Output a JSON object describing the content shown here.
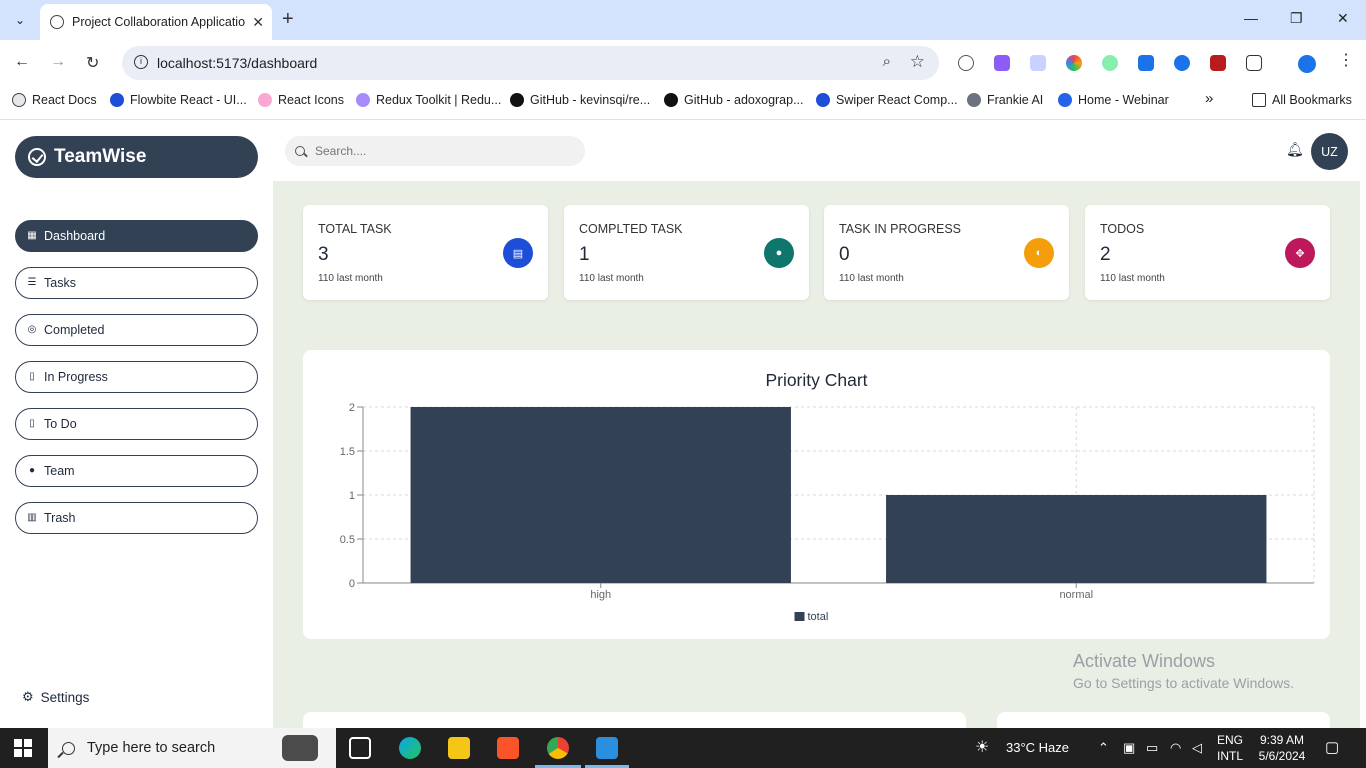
{
  "browser": {
    "tab_title": "Project Collaboration Applicatio",
    "url": "localhost:5173/dashboard",
    "bookmarks": [
      "React Docs",
      "Flowbite React - UI...",
      "React Icons",
      "Redux Toolkit | Redu...",
      "GitHub - kevinsqi/re...",
      "GitHub - adoxograp...",
      "Swiper React Comp...",
      "Frankie AI",
      "Home - Webinar"
    ],
    "all_bookmarks": "All Bookmarks",
    "overflow": "»"
  },
  "app": {
    "brand": "TeamWise",
    "search_placeholder": "Search....",
    "avatar_initials": "UZ",
    "nav": [
      "Dashboard",
      "Tasks",
      "Completed",
      "In Progress",
      "To Do",
      "Team",
      "Trash"
    ],
    "settings_label": "Settings"
  },
  "stats": [
    {
      "label": "TOTAL TASK",
      "value": "3",
      "sub": "110 last month",
      "color": "#1d4ed8"
    },
    {
      "label": "COMPLTED TASK",
      "value": "1",
      "sub": "110 last month",
      "color": "#0f766e"
    },
    {
      "label": "TASK IN PROGRESS",
      "value": "0",
      "sub": "110 last month",
      "color": "#f59e0b"
    },
    {
      "label": "TODOS",
      "value": "2",
      "sub": "110 last month",
      "color": "#be185d"
    }
  ],
  "chart_title": "Priority Chart",
  "chart_data": {
    "type": "bar",
    "title": "Priority Chart",
    "categories": [
      "high",
      "normal"
    ],
    "series": [
      {
        "name": "total",
        "values": [
          2,
          1
        ]
      }
    ],
    "ylim": [
      0,
      2
    ],
    "yticks": [
      "0",
      "0.5",
      "1",
      "1.5",
      "2"
    ],
    "grid": true,
    "legend": "bottom",
    "color": "#334155"
  },
  "watermark": {
    "line1": "Activate Windows",
    "line2": "Go to Settings to activate Windows."
  },
  "taskbar": {
    "search_placeholder": "Type here to search",
    "weather": "33°C  Haze",
    "lang1": "ENG",
    "lang2": "INTL",
    "time": "9:39 AM",
    "date": "5/6/2024"
  }
}
